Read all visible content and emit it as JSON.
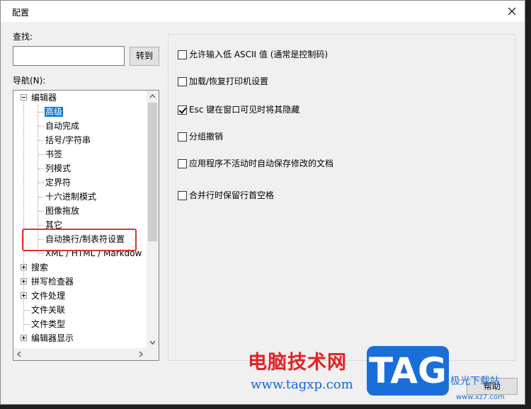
{
  "window": {
    "title": "配置"
  },
  "search": {
    "label": "查找:",
    "value": "",
    "goto_button": "转到"
  },
  "nav": {
    "label": "导航(N):",
    "tree": [
      {
        "label": "编辑器",
        "expander": "minus"
      },
      {
        "label": "高级",
        "selected": true
      },
      {
        "label": "自动完成"
      },
      {
        "label": "括号/字符串"
      },
      {
        "label": "书签"
      },
      {
        "label": "列模式"
      },
      {
        "label": "定界符"
      },
      {
        "label": "十六进制模式"
      },
      {
        "label": "图像拖放"
      },
      {
        "label": "其它"
      },
      {
        "label": "自动换行/制表符设置"
      },
      {
        "label": "XML / HTML / Markdow"
      },
      {
        "label": "搜索",
        "expander": "plus"
      },
      {
        "label": "拼写检查器",
        "expander": "plus"
      },
      {
        "label": "文件处理",
        "expander": "plus"
      },
      {
        "label": "文件关联"
      },
      {
        "label": "文件类型"
      },
      {
        "label": "编辑器显示",
        "expander": "plus"
      }
    ]
  },
  "options": [
    {
      "label": "允许输入低 ASCII 值 (通常是控制码)",
      "checked": false
    },
    {
      "label": "加载/恢复打印机设置",
      "checked": false
    },
    {
      "label": "Esc 键在窗口可见时将其隐藏",
      "checked": true
    },
    {
      "label": "分组撤销",
      "checked": false
    },
    {
      "label": "应用程序不活动时自动保存修改的文档",
      "checked": false
    },
    {
      "label": "合并行时保留行首空格",
      "checked": false
    }
  ],
  "buttons": {
    "help": "帮助"
  },
  "watermark": {
    "brand": "电脑技术网",
    "url": "www.tagxp.com",
    "badge": "TAG",
    "side_text": "极光下载站",
    "side_url": "www.xz7.com"
  },
  "highlight_color": "#e0342a",
  "selection_color": "#0078d7"
}
